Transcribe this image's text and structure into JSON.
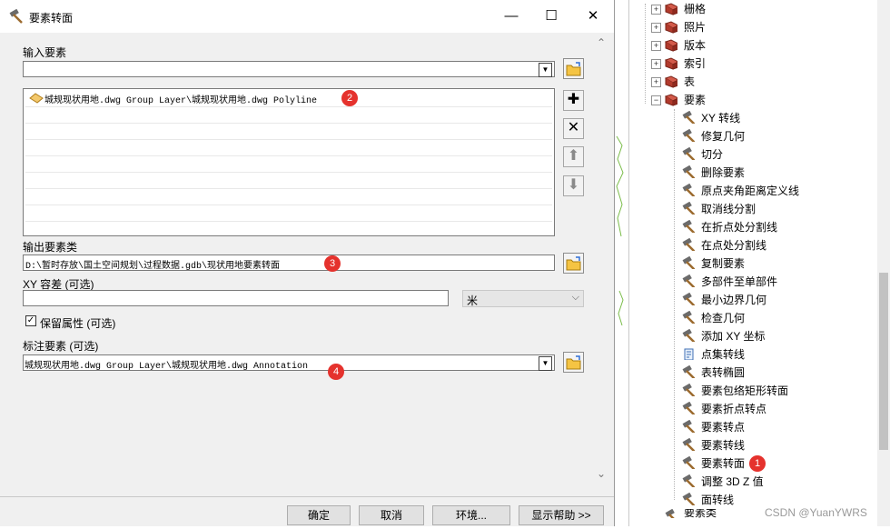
{
  "dialog": {
    "title": "要素转面",
    "window_icon": "hammer-icon",
    "input_label": "输入要素",
    "input_value": "",
    "list_items": [
      {
        "text": "城规现状用地.dwg Group Layer\\城规现状用地.dwg Polyline",
        "icon": "polyline-layer-icon"
      }
    ],
    "output_label": "输出要素类",
    "output_value": "D:\\暂时存放\\国土空间规划\\过程数据.gdb\\现状用地要素转面",
    "xy_label": "XY 容差 (可选)",
    "xy_value": "",
    "xy_unit": "米",
    "keep_attr_label": "保留属性 (可选)",
    "keep_attr_checked": true,
    "label_features_label": "标注要素 (可选)",
    "label_features_value": "城规现状用地.dwg Group Layer\\城规现状用地.dwg Annotation",
    "buttons": {
      "ok": "确定",
      "cancel": "取消",
      "env": "环境...",
      "help": "显示帮助 >>"
    },
    "badges": [
      "1",
      "2",
      "3",
      "4"
    ]
  },
  "tree": {
    "collapsed": [
      "栅格",
      "照片",
      "版本",
      "索引",
      "表"
    ],
    "expanded": "要素",
    "tools": [
      "XY 转线",
      "修复几何",
      "切分",
      "删除要素",
      "原点夹角距离定义线",
      "取消线分割",
      "在折点处分割线",
      "在点处分割线",
      "复制要素",
      "多部件至单部件",
      "最小边界几何",
      "检查几何",
      "添加 XY 坐标",
      "点集转线",
      "表转椭圆",
      "要素包络矩形转面",
      "要素折点转点",
      "要素转点",
      "要素转线",
      "要素转面",
      "调整 3D Z 值",
      "面转线"
    ],
    "script_tool_index": 13,
    "next_partial": "要素类",
    "watermark": "CSDN @YuanYWRS"
  },
  "colors": {
    "badge": "#e5322d",
    "toolset_icon": "#c0392b"
  }
}
